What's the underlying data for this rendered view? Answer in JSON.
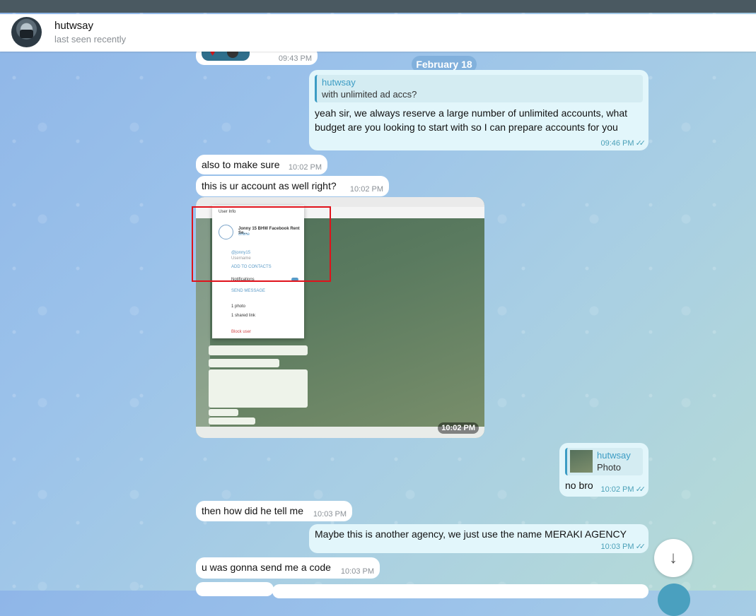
{
  "header": {
    "name": "hutwsay",
    "status": "last seen recently"
  },
  "date_separator": "February 18",
  "messages": {
    "top_partial_time": "09:43 PM",
    "m1": {
      "reply_name": "hutwsay",
      "reply_text": "with unlimited ad accs?",
      "text": "yeah sir, we always reserve a large number of unlimited accounts, what budget are you looking to start with so I can prepare accounts for you",
      "time": "09:46 PM"
    },
    "m2": {
      "text": "also to make sure",
      "time": "10:02 PM"
    },
    "m3": {
      "text": "this is ur account as well right?",
      "time": "10:02 PM"
    },
    "photo": {
      "time": "10:02 PM",
      "dialog_title": "User Info",
      "dialog_name": "Jonny 15 BHW Facebook Rent Se...",
      "dialog_status": "online",
      "dialog_username": "@jonny15",
      "dialog_username_label": "Username",
      "dialog_add": "ADD TO CONTACTS",
      "dialog_notifications": "Notifications",
      "dialog_send": "SEND MESSAGE",
      "dialog_photos": "1 photo",
      "dialog_links": "1 shared link",
      "dialog_block": "Block user"
    },
    "m4": {
      "reply_name": "hutwsay",
      "reply_text": "Photo",
      "text": "no bro",
      "time": "10:02 PM"
    },
    "m5": {
      "text": "then how did he tell me",
      "time": "10:03 PM"
    },
    "m6": {
      "text": "Maybe this is another agency, we just use the name MERAKI AGENCY",
      "time": "10:03 PM"
    },
    "m7": {
      "text": "u was gonna send me a code",
      "time": "10:03 PM"
    }
  },
  "icons": {
    "double_check": "✓✓",
    "scroll_down": "↓"
  }
}
